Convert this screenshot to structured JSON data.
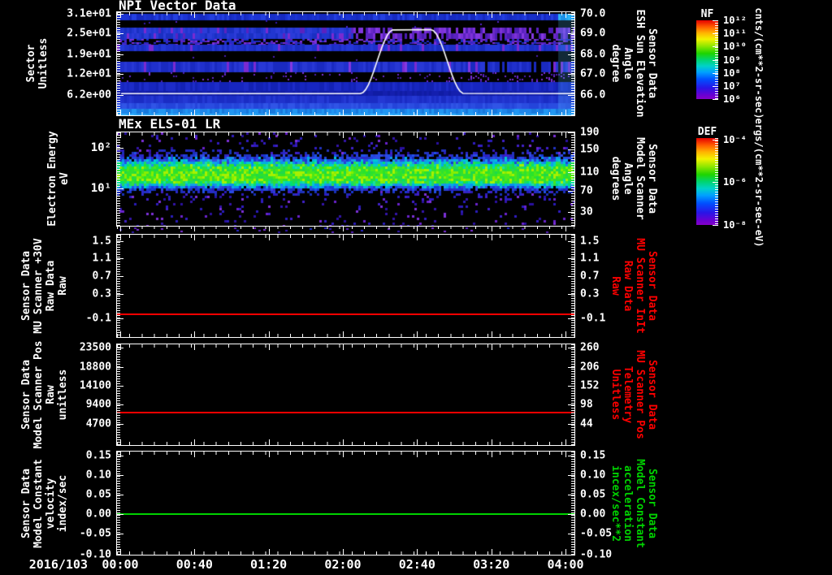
{
  "colors": {
    "background": "#000000",
    "axis": "#ffffff",
    "red_series": "#ff0000",
    "green_series": "#00d200",
    "white_series": "#ffffff"
  },
  "xaxis": {
    "date_label": "2016/103",
    "tick_labels": [
      "00:00",
      "00:40",
      "01:20",
      "02:00",
      "02:40",
      "03:20",
      "04:00"
    ]
  },
  "chart_data": [
    {
      "type": "heatmap",
      "title": "NPI Vector Data",
      "ylabel": "Sector\nUnitless",
      "yticks_left": [
        "3.1e+01",
        "2.5e+01",
        "1.9e+01",
        "1.2e+01",
        "6.2e+00"
      ],
      "right_axis_label": "Sensor Data\nESH Sun Elevation\nAngle\ndegree",
      "right_axis_label_color": "#ffffff",
      "yticks_right": [
        "70.0",
        "69.0",
        "68.0",
        "67.0",
        "66.0"
      ],
      "colorbar": {
        "name": "NF",
        "tick_labels": [
          "10¹²",
          "10¹¹",
          "10¹⁰",
          "10⁹",
          "10⁸",
          "10⁷",
          "10⁶"
        ],
        "units": "cnts/(cm**2-sr-sec)",
        "scale": "rainbow-log"
      },
      "content_note": "horizontal sector bands of blue/purple counts separated by dark gaps; brighter cyan bands near bottom and at right edge",
      "overlay_series": {
        "name": "ESH Sun Elevation Angle",
        "color": "#ffffff",
        "x_minutes": [
          0,
          129,
          147,
          167,
          185,
          245
        ],
        "values": [
          66.1,
          66.1,
          69.3,
          69.3,
          66.1,
          66.1
        ]
      }
    },
    {
      "type": "heatmap",
      "title": "MEx ELS-01 LR",
      "ylabel": "Electron Energy\neV",
      "yticks_left": [
        "10²",
        "10¹"
      ],
      "right_axis_label": "Sensor Data\nModel Scanner\nAngle\ndegrees",
      "right_axis_label_color": "#ffffff",
      "yticks_right": [
        "190",
        "150",
        "110",
        "70",
        "30"
      ],
      "colorbar": {
        "name": "DEF",
        "tick_labels": [
          "10⁻⁴",
          "10⁻⁶",
          "10⁻⁸"
        ],
        "units": "ergs/(cm**2-sr-sec-eV)",
        "scale": "rainbow-log"
      },
      "content_note": "bright green energy-flux band near 10-30 eV over blue noise, sparse purple speckles at low energies; detached speckle strip below axis"
    },
    {
      "type": "line",
      "ylabel": "Sensor Data\nMU Scanner +30V\nRaw Data\nRaw",
      "yticks_left": [
        "1.5",
        "1.1",
        "0.7",
        "0.3",
        "-0.1"
      ],
      "right_axis_label": "Sensor Data\nMU Scanner InIt\nRaw Data\nRaw",
      "right_axis_label_color": "#ff0000",
      "yticks_right": [
        "1.5",
        "1.1",
        "0.7",
        "0.3",
        "-0.1"
      ],
      "ylim": [
        -0.28,
        1.53
      ],
      "series": [
        {
          "name": "MU Scanner +30V Raw",
          "color": "#ff0000",
          "constant_value": 0.0
        }
      ]
    },
    {
      "type": "line",
      "ylabel": "Sensor Data\nModel Scanner Pos\nRaw\nunitless",
      "yticks_left": [
        "23500",
        "18800",
        "14100",
        "9400",
        "4700"
      ],
      "right_axis_label": "Sensor Data\nMU Scanner Pos\nTelemetry\nUnitless",
      "right_axis_label_color": "#ff0000",
      "yticks_right": [
        "260",
        "206",
        "152",
        "98",
        "44"
      ],
      "ylim": [
        0,
        24500
      ],
      "series": [
        {
          "name": "Model Scanner Pos Raw",
          "color": "#ff0000",
          "constant_value": 7800
        }
      ]
    },
    {
      "type": "line",
      "ylabel": "Sensor Data\nModel Constant\nvelocity\nindex/sec",
      "yticks_left": [
        "0.15",
        "0.10",
        "0.05",
        "0.00",
        "-0.05",
        "-0.10"
      ],
      "right_axis_label": "Sensor Data\nModel Constant\nacceleration\nincex/sec**2",
      "right_axis_label_color": "#00d200",
      "yticks_right": [
        "0.15",
        "0.10",
        "0.05",
        "0.00",
        "-0.05",
        "-0.10"
      ],
      "ylim": [
        -0.102,
        0.157
      ],
      "series": [
        {
          "name": "Model Constant velocity",
          "color": "#00d200",
          "constant_value": 0.0
        }
      ]
    }
  ]
}
